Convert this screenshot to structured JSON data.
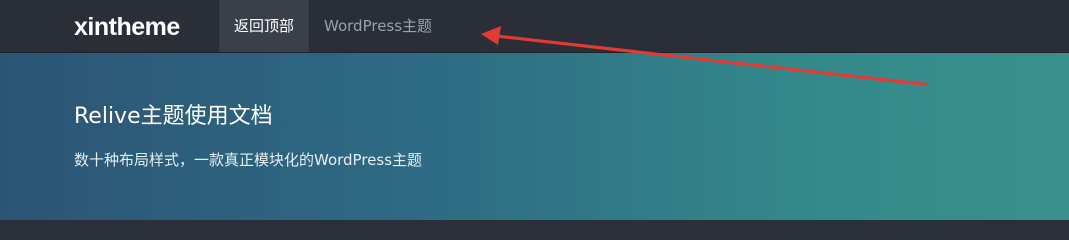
{
  "header": {
    "logo_text": "xintheme",
    "nav": [
      {
        "label": "返回顶部",
        "active": true
      },
      {
        "label": "WordPress主题",
        "active": false
      }
    ]
  },
  "hero": {
    "title": "Relive主题使用文档",
    "subtitle": "数十种布局样式，一款真正模块化的WordPress主题"
  },
  "annotation": {
    "color": "#e53935",
    "icon": "red-arrow-annotation"
  }
}
